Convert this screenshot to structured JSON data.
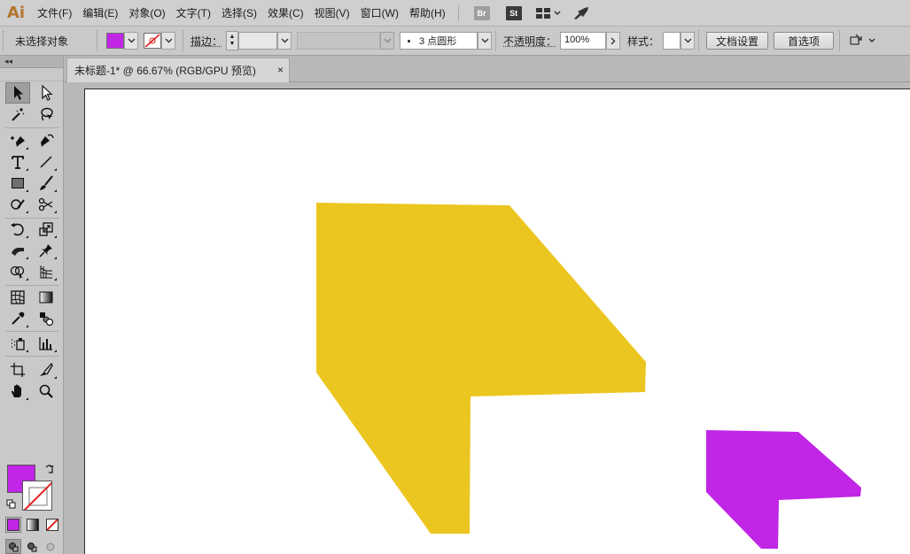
{
  "app": {
    "logo": "Ai"
  },
  "menu": [
    "文件(F)",
    "编辑(E)",
    "对象(O)",
    "文字(T)",
    "选择(S)",
    "效果(C)",
    "视图(V)",
    "窗口(W)",
    "帮助(H)"
  ],
  "apps": {
    "br": "Br",
    "st": "St"
  },
  "control": {
    "selection_status": "未选择对象",
    "fill_color": "#c125e6",
    "stroke_label": "描边：",
    "brush_value": "3 点圆形",
    "opacity_label": "不透明度：",
    "opacity_value": "100%",
    "style_label": "样式：",
    "doc_setup_button": "文档设置",
    "preferences_button": "首选项"
  },
  "tools_panel": {
    "collapse_glyph": "◂◂"
  },
  "document": {
    "tab_title": "未标题-1* @ 66.67% (RGB/GPU 预览)",
    "close_glyph": "×"
  },
  "artwork": {
    "yellow_shape_color": "#ecc620",
    "purple_shape_color": "#c125e6"
  },
  "colors": {
    "default_fill": "#c125e6",
    "none_stroke": "#e02020"
  }
}
